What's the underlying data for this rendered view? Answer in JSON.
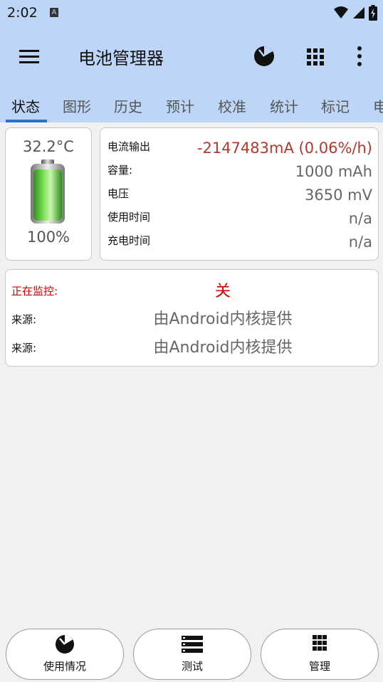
{
  "status_bar": {
    "time": "2:02",
    "notification_letter": "A"
  },
  "app_bar": {
    "title": "电池管理器",
    "menu_icon": "hamburger-menu-icon",
    "usage_icon": "pie-chart-icon",
    "grid_icon": "grid-icon",
    "more_icon": "more-vertical-icon"
  },
  "tabs": [
    {
      "label": "状态",
      "active": true
    },
    {
      "label": "图形"
    },
    {
      "label": "历史"
    },
    {
      "label": "预计"
    },
    {
      "label": "校准"
    },
    {
      "label": "统计"
    },
    {
      "label": "标记"
    },
    {
      "label": "电"
    }
  ],
  "battery": {
    "temperature": "32.2°C",
    "percent": "100%",
    "level": 1.0
  },
  "info": [
    {
      "label": "电流输出",
      "value": "-2147483mA (0.06%/h)",
      "highlight": true
    },
    {
      "label": "容量:",
      "value": "1000 mAh"
    },
    {
      "label": "电压",
      "value": "3650 mV"
    },
    {
      "label": "使用时间",
      "value": "n/a"
    },
    {
      "label": "充电时间",
      "value": "n/a"
    }
  ],
  "monitor": {
    "label": "正在监控:",
    "value": "关",
    "sources": [
      {
        "label": "来源:",
        "value": "由Android内核提供"
      },
      {
        "label": "来源:",
        "value": "由Android内核提供"
      }
    ]
  },
  "bottom_buttons": [
    {
      "label": "使用情况",
      "icon": "pie-chart-icon"
    },
    {
      "label": "测试",
      "icon": "list-icon"
    },
    {
      "label": "管理",
      "icon": "grid-icon"
    }
  ],
  "colors": {
    "accent_bar": "#bdd6f7",
    "tab_indicator": "#2c6fd1",
    "warning_red": "#d00000",
    "current_red": "#b03a2e",
    "battery_green": "#5fd13a"
  }
}
